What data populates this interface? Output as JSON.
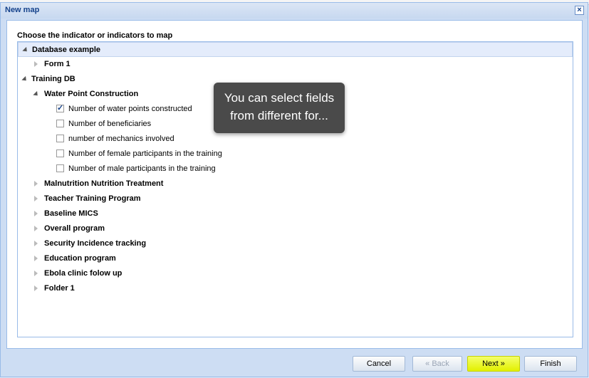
{
  "window": {
    "title": "New map"
  },
  "panel": {
    "heading": "Choose the indicator or indicators to map"
  },
  "tree": {
    "database_example": "Database example",
    "form1": "Form 1",
    "training_db": "Training DB",
    "water_point": "Water Point Construction",
    "fields": [
      {
        "label": "Number of water points constructed",
        "checked": true
      },
      {
        "label": "Number of beneficiaries",
        "checked": false
      },
      {
        "label": "number of mechanics involved",
        "checked": false
      },
      {
        "label": "Number of female participants in the training",
        "checked": false
      },
      {
        "label": "Number of male participants in the training",
        "checked": false
      }
    ],
    "forms": [
      "Malnutrition Nutrition Treatment",
      "Teacher Training Program",
      "Baseline MICS",
      "Overall program",
      "Security Incidence tracking",
      "Education program",
      "Ebola clinic folow up",
      "Folder 1"
    ]
  },
  "tooltip": {
    "line1": "You can select fields",
    "line2": "from different for..."
  },
  "buttons": {
    "cancel": "Cancel",
    "back": "« Back",
    "next": "Next »",
    "finish": "Finish"
  },
  "colors": {
    "title": "#15428b",
    "next_highlight": "#e2f000"
  }
}
